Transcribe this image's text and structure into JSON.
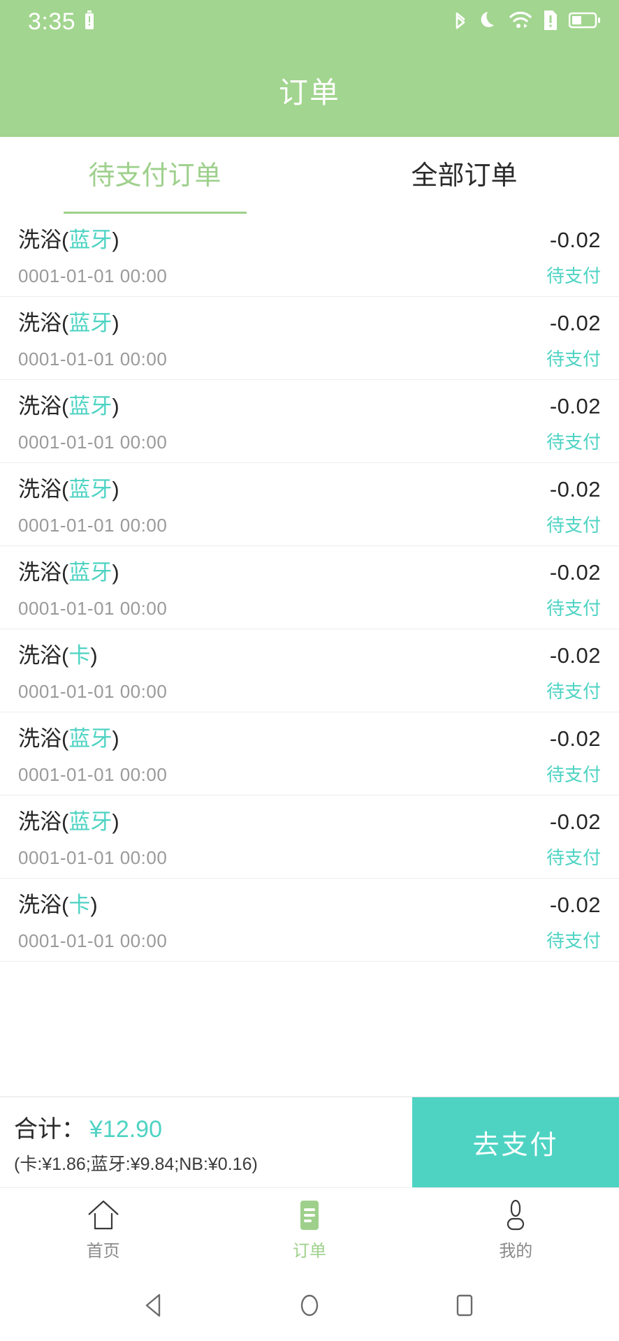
{
  "status_bar": {
    "time": "3:35",
    "icons": [
      "battery-small-icon",
      "bluetooth-icon",
      "moon-icon",
      "wifi-icon",
      "sim-alert-icon",
      "battery-icon"
    ]
  },
  "header": {
    "title": "订单",
    "background_color": "#a2d58f"
  },
  "tabs": [
    {
      "label": "待支付订单",
      "active": true
    },
    {
      "label": "全部订单",
      "active": false
    }
  ],
  "colors": {
    "header_green": "#a2d58f",
    "accent_teal": "#4ed3c3",
    "tab_active_green": "#9ed08c",
    "text_primary": "#262626",
    "text_muted": "#9a9a9a"
  },
  "orders": [
    {
      "title_main": "洗浴",
      "channel": "蓝牙",
      "date": "0001-01-01 00:00",
      "amount": "-0.02",
      "status": "待支付"
    },
    {
      "title_main": "洗浴",
      "channel": "蓝牙",
      "date": "0001-01-01 00:00",
      "amount": "-0.02",
      "status": "待支付"
    },
    {
      "title_main": "洗浴",
      "channel": "蓝牙",
      "date": "0001-01-01 00:00",
      "amount": "-0.02",
      "status": "待支付"
    },
    {
      "title_main": "洗浴",
      "channel": "蓝牙",
      "date": "0001-01-01 00:00",
      "amount": "-0.02",
      "status": "待支付"
    },
    {
      "title_main": "洗浴",
      "channel": "蓝牙",
      "date": "0001-01-01 00:00",
      "amount": "-0.02",
      "status": "待支付"
    },
    {
      "title_main": "洗浴",
      "channel": "卡",
      "date": "0001-01-01 00:00",
      "amount": "-0.02",
      "status": "待支付"
    },
    {
      "title_main": "洗浴",
      "channel": "蓝牙",
      "date": "0001-01-01 00:00",
      "amount": "-0.02",
      "status": "待支付"
    },
    {
      "title_main": "洗浴",
      "channel": "蓝牙",
      "date": "0001-01-01 00:00",
      "amount": "-0.02",
      "status": "待支付"
    },
    {
      "title_main": "洗浴",
      "channel": "卡",
      "date": "0001-01-01 00:00",
      "amount": "-0.02",
      "status": "待支付"
    }
  ],
  "summary": {
    "total_label": "合计：",
    "total_amount": "¥12.90",
    "breakdown": "(卡:¥1.86;蓝牙:¥9.84;NB:¥0.16)",
    "pay_button_label": "去支付"
  },
  "bottom_nav": [
    {
      "label": "首页",
      "icon": "home-icon",
      "active": false
    },
    {
      "label": "订单",
      "icon": "order-list-icon",
      "active": true
    },
    {
      "label": "我的",
      "icon": "person-icon",
      "active": false
    }
  ],
  "system_nav": [
    {
      "name": "back-button",
      "icon": "triangle-left-icon"
    },
    {
      "name": "home-button",
      "icon": "circle-icon"
    },
    {
      "name": "recents-button",
      "icon": "square-icon"
    }
  ]
}
